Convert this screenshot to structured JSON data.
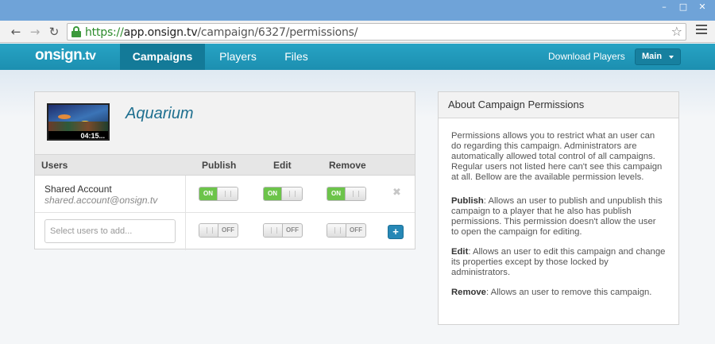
{
  "browser": {
    "url_scheme": "https://",
    "url_host": "app.onsign.tv",
    "url_path": "/campaign/6327/permissions/",
    "window_buttons": [
      "–",
      "□",
      "✕"
    ]
  },
  "app": {
    "logo_main": "onsign",
    "logo_suffix": ".tv",
    "nav": [
      "Campaigns",
      "Players",
      "Files"
    ],
    "download_label": "Download Players",
    "account_label": "Main"
  },
  "campaign": {
    "name": "Aquarium",
    "thumbnail_time": "04:15..."
  },
  "table": {
    "headers": [
      "Users",
      "Publish",
      "Edit",
      "Remove"
    ],
    "rows": [
      {
        "name": "Shared Account",
        "email": "shared.account@onsign.tv",
        "publish": "ON",
        "edit": "ON",
        "remove": "ON"
      }
    ],
    "add_row": {
      "placeholder": "Select users to add...",
      "publish": "OFF",
      "edit": "OFF",
      "remove": "OFF",
      "add_label": "+"
    },
    "remove_symbol": "✖"
  },
  "about": {
    "title": "About Campaign Permissions",
    "intro": "Permissions allows you to restrict what an user can do regarding this campaign. Administrators are automatically allowed total control of all campaigns. Regular users not listed here can't see this campaign at all. Bellow are the available permission levels.",
    "publish_term": "Publish",
    "publish_text": ": Allows an user to publish and unpublish this campaign to a player that he also has publish permissions. This permission doesn't allow the user to open the campaign for editing.",
    "edit_term": "Edit",
    "edit_text": ": Allows an user to edit this campaign and change its properties except by those locked by administrators.",
    "remove_term": "Remove",
    "remove_text": ": Allows an user to remove this campaign."
  }
}
